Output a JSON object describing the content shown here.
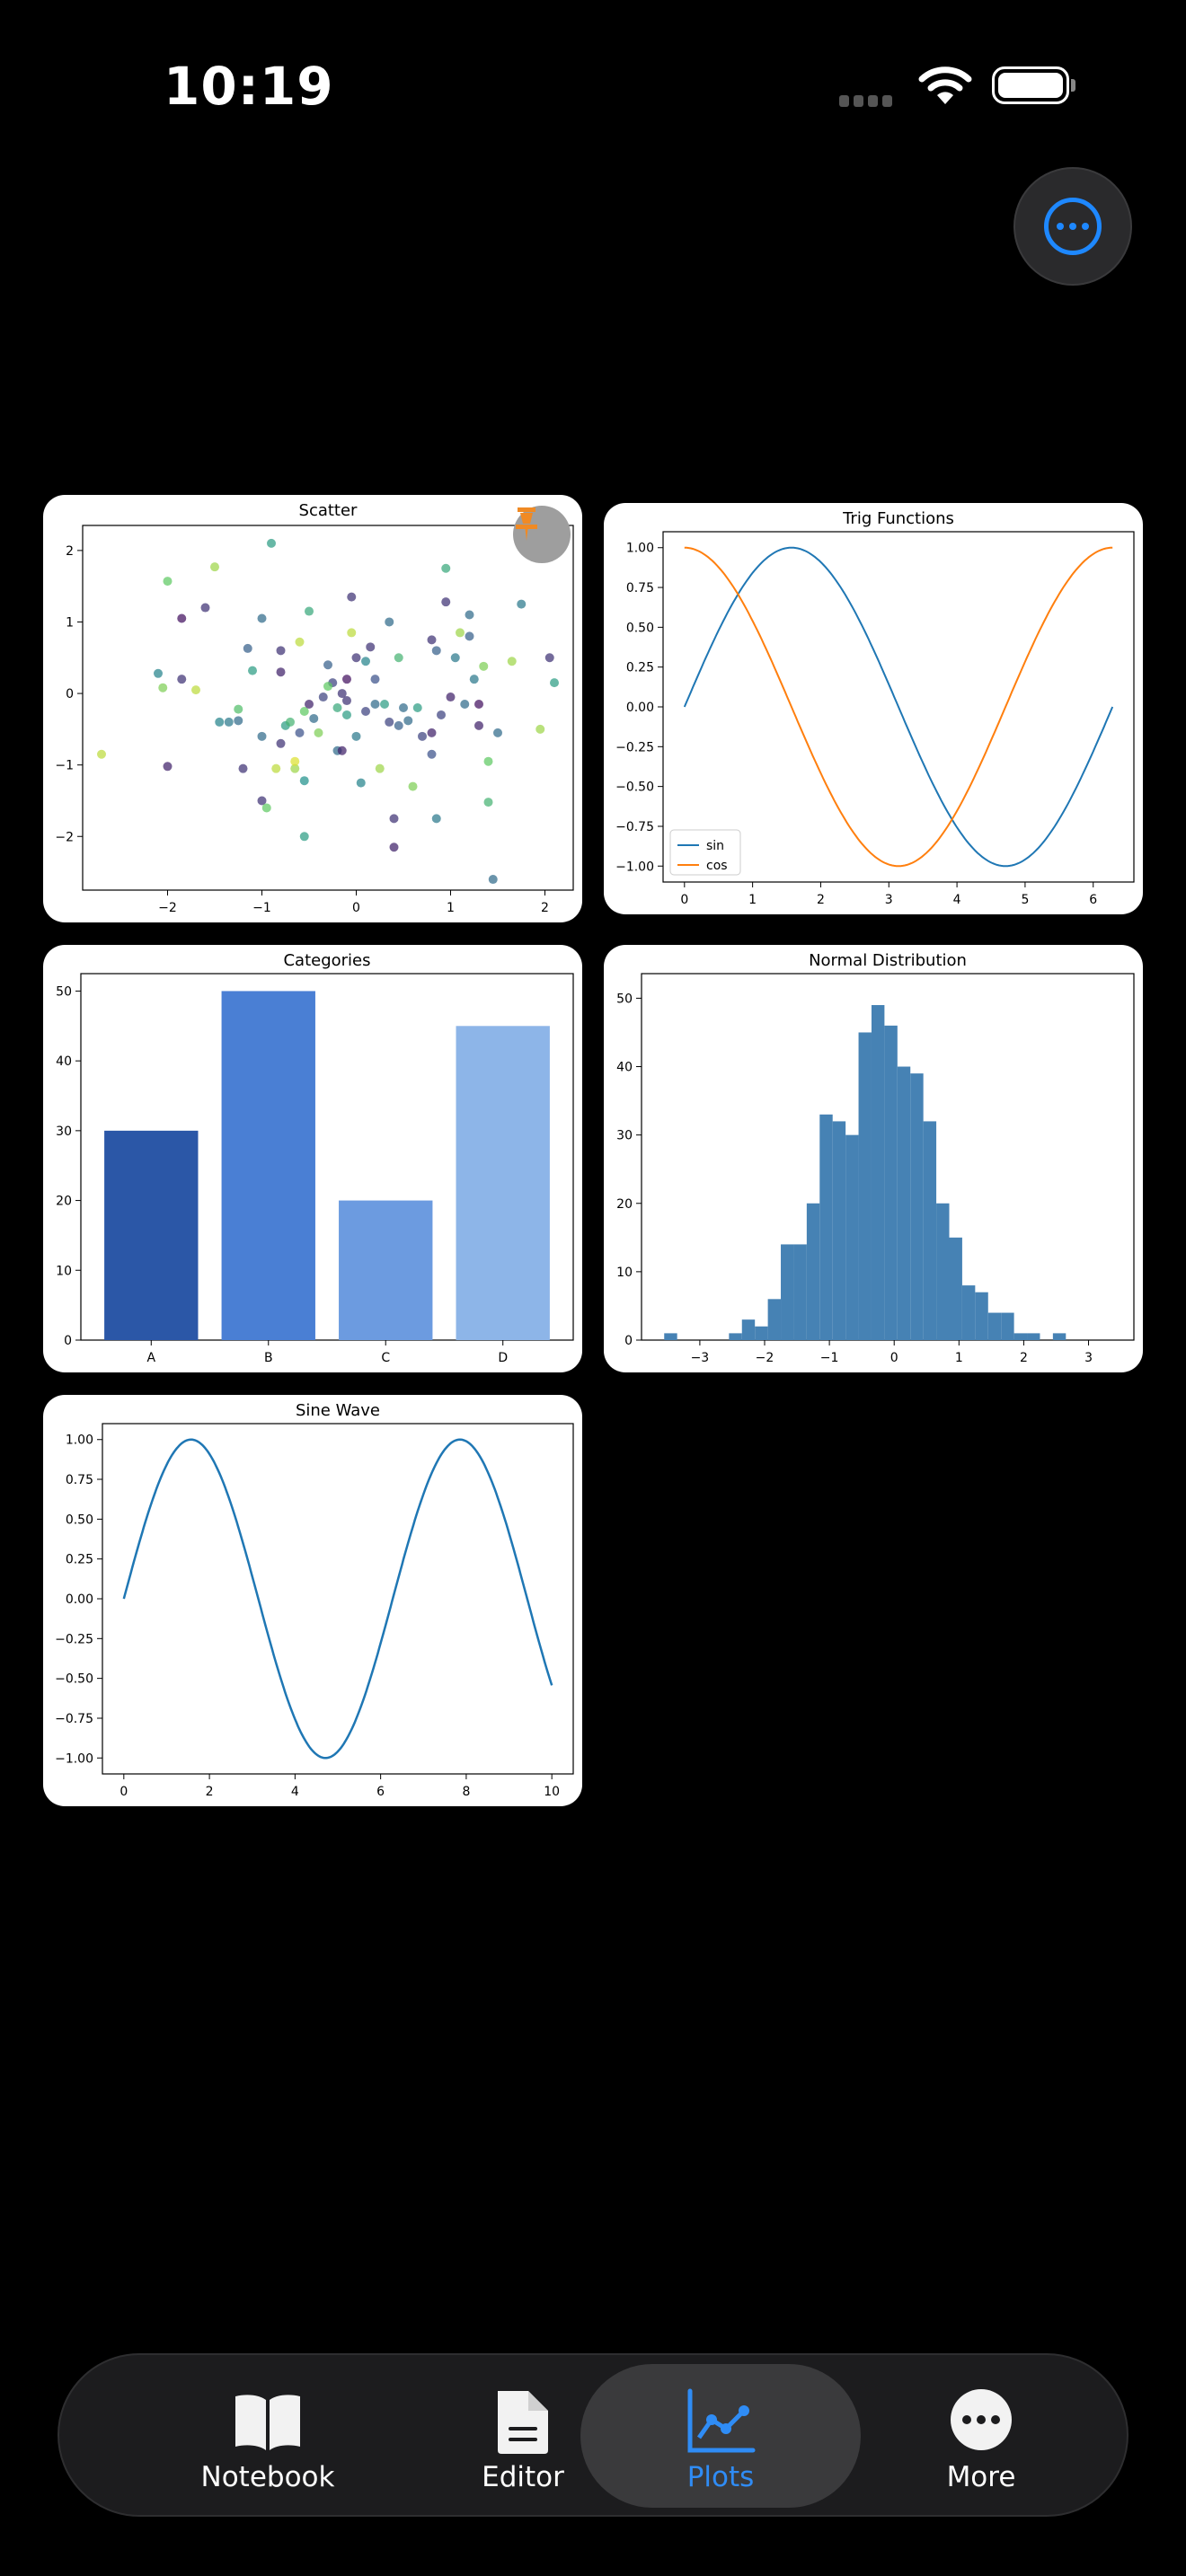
{
  "status_bar": {
    "time": "10:19"
  },
  "colors": {
    "accent": "#1e88ff",
    "background": "#000000",
    "card": "#ffffff",
    "line_blue": "#1f77b4",
    "line_orange": "#ff7f0e"
  },
  "plots": {
    "scatter": {
      "title": "Scatter"
    },
    "trig": {
      "title": "Trig Functions",
      "legend": [
        "sin",
        "cos"
      ]
    },
    "categories": {
      "title": "Categories"
    },
    "normal": {
      "title": "Normal Distribution"
    },
    "sine": {
      "title": "Sine Wave"
    }
  },
  "tabbar": {
    "items": [
      {
        "label": "Notebook",
        "icon": "book-icon",
        "active": false
      },
      {
        "label": "Editor",
        "icon": "document-icon",
        "active": false
      },
      {
        "label": "Plots",
        "icon": "chart-icon",
        "active": true
      },
      {
        "label": "More",
        "icon": "ellipsis-icon",
        "active": false
      }
    ]
  },
  "chart_data": [
    {
      "type": "scatter",
      "title": "Scatter",
      "xlim": [
        -2.9,
        2.3
      ],
      "ylim": [
        -2.75,
        2.35
      ],
      "xticks": [
        -2,
        -1,
        0,
        1,
        2
      ],
      "yticks": [
        -2,
        -1,
        0,
        1,
        2
      ],
      "points": [
        [
          -2.7,
          -0.85,
          0.9
        ],
        [
          -2.1,
          0.28,
          0.45
        ],
        [
          -2.05,
          0.08,
          0.8
        ],
        [
          -2.0,
          1.57,
          0.75
        ],
        [
          -2.0,
          -1.02,
          0.1
        ],
        [
          -1.85,
          1.05,
          0.05
        ],
        [
          -1.85,
          0.2,
          0.15
        ],
        [
          -1.7,
          0.05,
          0.9
        ],
        [
          -1.6,
          1.2,
          0.15
        ],
        [
          -1.5,
          1.77,
          0.85
        ],
        [
          -1.35,
          -0.4,
          0.4
        ],
        [
          -1.25,
          -0.38,
          0.35
        ],
        [
          -1.25,
          -0.22,
          0.7
        ],
        [
          -1.2,
          -1.05,
          0.15
        ],
        [
          -1.15,
          0.63,
          0.3
        ],
        [
          -1.1,
          0.32,
          0.55
        ],
        [
          -1.0,
          1.05,
          0.35
        ],
        [
          -1.0,
          -0.6,
          0.35
        ],
        [
          -1.0,
          -1.5,
          0.15
        ],
        [
          -0.95,
          -1.6,
          0.75
        ],
        [
          -0.9,
          2.1,
          0.55
        ],
        [
          -0.85,
          -1.05,
          0.9
        ],
        [
          -0.8,
          -0.7,
          0.15
        ],
        [
          -0.8,
          0.6,
          0.15
        ],
        [
          -0.8,
          0.3,
          0.1
        ],
        [
          -0.75,
          -0.45,
          0.55
        ],
        [
          -0.7,
          -0.4,
          0.65
        ],
        [
          -0.65,
          -1.05,
          0.85
        ],
        [
          -0.65,
          -0.95,
          0.95
        ],
        [
          -0.6,
          0.72,
          0.9
        ],
        [
          -0.6,
          -0.55,
          0.25
        ],
        [
          -0.55,
          -0.25,
          0.75
        ],
        [
          -0.55,
          -1.22,
          0.5
        ],
        [
          -0.55,
          -2.0,
          0.55
        ],
        [
          -0.5,
          1.15,
          0.6
        ],
        [
          -0.5,
          -0.15,
          0.1
        ],
        [
          -0.45,
          -0.35,
          0.35
        ],
        [
          -0.4,
          -0.55,
          0.8
        ],
        [
          -0.35,
          -0.05,
          0.2
        ],
        [
          -0.3,
          0.4,
          0.3
        ],
        [
          -0.25,
          0.15,
          0.2
        ],
        [
          -0.2,
          -0.8,
          0.35
        ],
        [
          -0.2,
          -0.2,
          0.6
        ],
        [
          -0.15,
          0.0,
          0.15
        ],
        [
          -0.15,
          -0.8,
          0.1
        ],
        [
          -0.1,
          0.2,
          0.05
        ],
        [
          -0.1,
          -0.1,
          0.15
        ],
        [
          -0.1,
          -0.3,
          0.55
        ],
        [
          -0.05,
          1.35,
          0.15
        ],
        [
          -0.05,
          0.85,
          0.9
        ],
        [
          0.0,
          0.5,
          0.15
        ],
        [
          0.0,
          -0.6,
          0.4
        ],
        [
          0.05,
          -1.25,
          0.45
        ],
        [
          0.1,
          -0.25,
          0.2
        ],
        [
          0.1,
          0.45,
          0.45
        ],
        [
          0.15,
          0.65,
          0.15
        ],
        [
          0.2,
          -0.15,
          0.35
        ],
        [
          0.25,
          -1.05,
          0.85
        ],
        [
          0.3,
          -0.15,
          0.55
        ],
        [
          0.35,
          1.0,
          0.35
        ],
        [
          0.35,
          -0.4,
          0.2
        ],
        [
          0.4,
          -1.75,
          0.15
        ],
        [
          0.4,
          -2.15,
          0.1
        ],
        [
          0.45,
          -0.45,
          0.3
        ],
        [
          0.45,
          0.5,
          0.65
        ],
        [
          0.5,
          -0.2,
          0.35
        ],
        [
          0.55,
          -0.38,
          0.35
        ],
        [
          0.6,
          -1.3,
          0.8
        ],
        [
          0.7,
          -0.6,
          0.2
        ],
        [
          0.8,
          0.75,
          0.15
        ],
        [
          0.8,
          -0.85,
          0.25
        ],
        [
          0.8,
          -0.55,
          0.1
        ],
        [
          0.85,
          0.6,
          0.3
        ],
        [
          0.85,
          -1.75,
          0.4
        ],
        [
          0.9,
          -0.3,
          0.2
        ],
        [
          0.95,
          1.75,
          0.6
        ],
        [
          0.95,
          1.28,
          0.15
        ],
        [
          1.0,
          -0.05,
          0.1
        ],
        [
          1.05,
          0.5,
          0.4
        ],
        [
          1.1,
          0.85,
          0.85
        ],
        [
          1.15,
          -0.15,
          0.35
        ],
        [
          1.2,
          1.1,
          0.35
        ],
        [
          1.2,
          0.8,
          0.3
        ],
        [
          1.3,
          -0.45,
          0.1
        ],
        [
          1.3,
          -0.15,
          0.05
        ],
        [
          1.35,
          0.38,
          0.8
        ],
        [
          1.4,
          -0.95,
          0.75
        ],
        [
          1.4,
          -1.52,
          0.65
        ],
        [
          1.45,
          -2.6,
          0.35
        ],
        [
          1.5,
          -0.55,
          0.35
        ],
        [
          1.65,
          0.45,
          0.85
        ],
        [
          1.75,
          1.25,
          0.4
        ],
        [
          1.95,
          -0.5,
          0.85
        ],
        [
          2.05,
          0.5,
          0.15
        ],
        [
          2.1,
          0.15,
          0.55
        ],
        [
          1.25,
          0.2,
          0.4
        ],
        [
          -0.3,
          0.1,
          0.75
        ],
        [
          0.2,
          0.2,
          0.25
        ],
        [
          -1.45,
          -0.4,
          0.45
        ],
        [
          0.65,
          -0.2,
          0.55
        ]
      ]
    },
    {
      "type": "line",
      "title": "Trig Functions",
      "xlim": [
        -0.314,
        6.597
      ],
      "ylim": [
        -1.1,
        1.1
      ],
      "xticks": [
        0,
        1,
        2,
        3,
        4,
        5,
        6
      ],
      "yticks": [
        1.0,
        0.75,
        0.5,
        0.25,
        0.0,
        -0.25,
        -0.5,
        -0.75,
        -1.0
      ],
      "x_range": [
        0,
        6.283
      ],
      "series": [
        {
          "name": "sin",
          "function": "sin",
          "color": "#1f77b4"
        },
        {
          "name": "cos",
          "function": "cos",
          "color": "#ff7f0e"
        }
      ],
      "legend": "lower-left"
    },
    {
      "type": "bar",
      "title": "Categories",
      "categories": [
        "A",
        "B",
        "C",
        "D"
      ],
      "values": [
        30,
        50,
        20,
        45
      ],
      "colors": [
        "#2b57a7",
        "#4a7fd4",
        "#6c9be0",
        "#8db5e8"
      ],
      "ylim": [
        0,
        52.5
      ],
      "yticks": [
        0,
        10,
        20,
        30,
        40,
        50
      ]
    },
    {
      "type": "bar",
      "title": "Normal Distribution",
      "bins_start": -3.55,
      "bin_width": 0.2,
      "counts": [
        1,
        0,
        0,
        0,
        0,
        1,
        3,
        2,
        6,
        14,
        14,
        20,
        33,
        32,
        30,
        45,
        49,
        46,
        40,
        39,
        32,
        20,
        15,
        8,
        7,
        4,
        4,
        1,
        1,
        0,
        1
      ],
      "xlim": [
        -3.9,
        3.7
      ],
      "ylim": [
        0,
        53.6
      ],
      "xticks": [
        -3,
        -2,
        -1,
        0,
        1,
        2,
        3
      ],
      "yticks": [
        0,
        10,
        20,
        30,
        40,
        50
      ],
      "color": "#4682b4"
    },
    {
      "type": "line",
      "title": "Sine Wave",
      "xlim": [
        -0.5,
        10.5
      ],
      "ylim": [
        -1.1,
        1.1
      ],
      "xticks": [
        0,
        2,
        4,
        6,
        8,
        10
      ],
      "yticks": [
        1.0,
        0.75,
        0.5,
        0.25,
        0.0,
        -0.25,
        -0.5,
        -0.75,
        -1.0
      ],
      "x_range": [
        0,
        10
      ],
      "series": [
        {
          "function": "sin",
          "color": "#1f77b4"
        }
      ]
    }
  ]
}
